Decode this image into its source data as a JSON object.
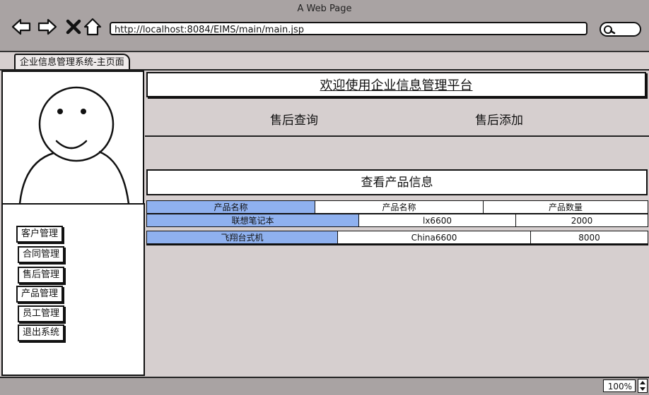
{
  "window": {
    "title": "A Web Page"
  },
  "browser": {
    "url": "http://localhost:8084/EIMS/main/main.jsp",
    "zoom": "100%",
    "tab_label": "企业信息管理系统-主页面"
  },
  "header": {
    "welcome": "欢迎使用企业信息管理平台"
  },
  "subnav": {
    "items": [
      "售后查询",
      "售后添加"
    ]
  },
  "sidebar": {
    "items": [
      "客户管理",
      "合同管理",
      "售后管理",
      "产品管理",
      "员工管理",
      "退出系统"
    ]
  },
  "products": {
    "title": "查看产品信息",
    "columns": [
      "产品名称",
      "产品名称",
      "产品数量"
    ],
    "rows": [
      [
        "联想笔记本",
        "lx6600",
        "2000"
      ],
      [
        "飞翔台式机",
        "China6600",
        "8000"
      ]
    ]
  },
  "colors": {
    "highlight": "#8fb1ef",
    "background": "#d6cfcf",
    "chrome": "#a9a3a3"
  },
  "icons": [
    "back-arrow-icon",
    "forward-arrow-icon",
    "close-icon",
    "home-icon",
    "search-icon",
    "avatar-icon",
    "spinner-icon"
  ]
}
